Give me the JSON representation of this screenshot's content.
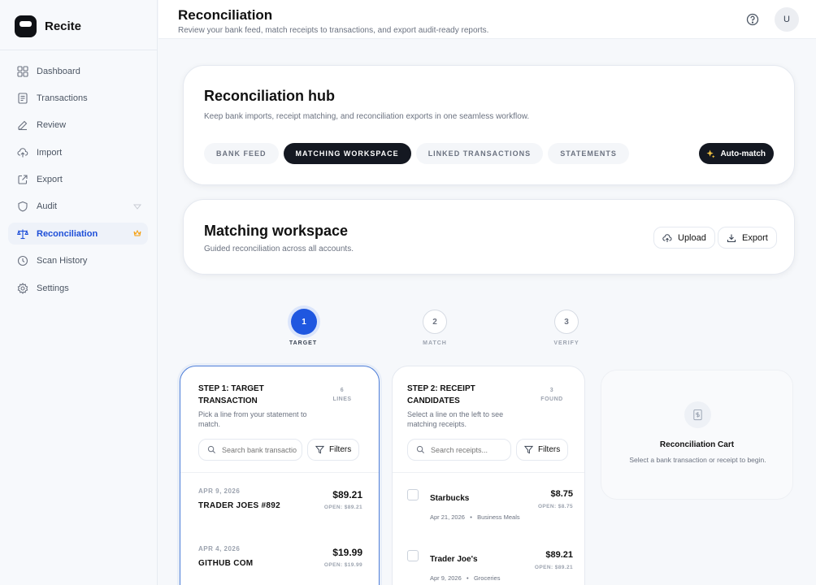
{
  "brand": {
    "name": "Recite"
  },
  "sidebar": {
    "items": [
      {
        "label": "Dashboard",
        "icon": "dashboard-icon"
      },
      {
        "label": "Transactions",
        "icon": "receipt-icon"
      },
      {
        "label": "Review",
        "icon": "edit-icon"
      },
      {
        "label": "Import",
        "icon": "cloud-upload-icon"
      },
      {
        "label": "Export",
        "icon": "export-icon"
      },
      {
        "label": "Audit",
        "icon": "shield-icon"
      },
      {
        "label": "Reconciliation",
        "icon": "scale-icon",
        "active": true
      },
      {
        "label": "Scan History",
        "icon": "clock-icon"
      },
      {
        "label": "Settings",
        "icon": "gear-icon"
      }
    ]
  },
  "header": {
    "title": "Reconciliation",
    "subtitle": "Review your bank feed, match receipts to transactions, and export audit-ready reports.",
    "avatar_initial": "U"
  },
  "hub": {
    "title": "Reconciliation hub",
    "description": "Keep bank imports, receipt matching, and reconciliation exports in one seamless workflow.",
    "tabs": [
      {
        "label": "BANK FEED"
      },
      {
        "label": "MATCHING WORKSPACE",
        "active": true
      },
      {
        "label": "LINKED TRANSACTIONS"
      },
      {
        "label": "STATEMENTS"
      }
    ],
    "automatch_label": "Auto-match"
  },
  "workspace": {
    "title": "Matching workspace",
    "description": "Guided reconciliation across all accounts.",
    "upload_label": "Upload",
    "export_label": "Export"
  },
  "stepper": [
    {
      "number": "1",
      "label": "TARGET",
      "active": true
    },
    {
      "number": "2",
      "label": "MATCH"
    },
    {
      "number": "3",
      "label": "VERIFY"
    }
  ],
  "step1": {
    "title": "STEP 1: TARGET TRANSACTION",
    "count": "6",
    "count_label": "LINES",
    "description": "Pick a line from your statement to match.",
    "search_placeholder": "Search bank transactions...",
    "filters_label": "Filters",
    "transactions": [
      {
        "date": "APR 9, 2026",
        "name": "TRADER JOES #892",
        "amount": "$89.21",
        "open": "OPEN: $89.21"
      },
      {
        "date": "APR 4, 2026",
        "name": "GITHUB COM",
        "amount": "$19.99",
        "open": "OPEN: $19.99"
      }
    ]
  },
  "step2": {
    "title": "STEP 2: RECEIPT CANDIDATES",
    "count": "3",
    "count_label": "FOUND",
    "description": "Select a line on the left to see matching receipts.",
    "search_placeholder": "Search receipts...",
    "filters_label": "Filters",
    "candidates": [
      {
        "name": "Starbucks",
        "date": "Apr 21, 2026",
        "category": "Business Meals",
        "amount": "$8.75",
        "open": "OPEN: $8.75"
      },
      {
        "name": "Trader Joe's",
        "date": "Apr 9, 2026",
        "category": "Groceries",
        "amount": "$89.21",
        "open": "OPEN: $89.21"
      }
    ]
  },
  "cart": {
    "title": "Reconciliation Cart",
    "description": "Select a bank transaction or receipt to begin."
  }
}
